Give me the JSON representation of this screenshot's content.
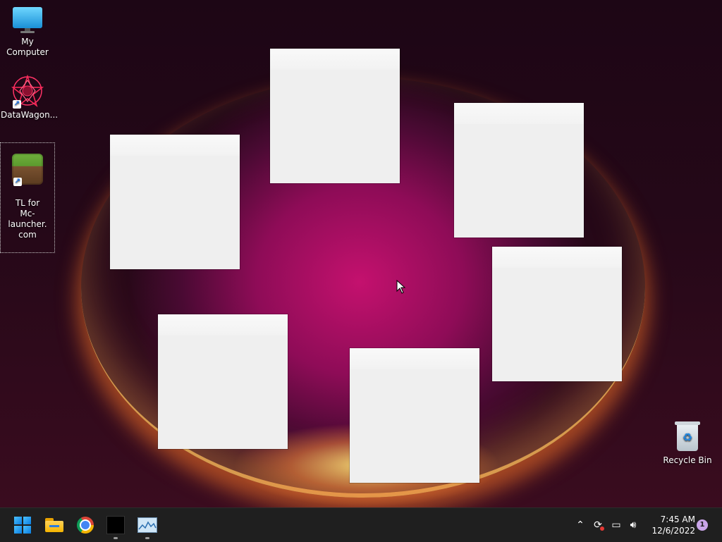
{
  "desktop": {
    "icons": [
      {
        "label": "My Computer"
      },
      {
        "label": "DataWagon..."
      },
      {
        "label": "TL for\nMc-launcher.\ncom"
      },
      {
        "label": "Recycle Bin"
      }
    ]
  },
  "taskbar": {
    "apps": [
      "start-icon",
      "file-explorer-icon",
      "chrome-icon",
      "black-app-icon",
      "monitor-app-icon"
    ],
    "clock": {
      "time": "7:45 AM",
      "date": "12/6/2022"
    },
    "notification_count": "1"
  },
  "colors": {
    "taskbar_bg": "#1f1f1f",
    "note_bg": "#efefef",
    "accent": "#0a7de0"
  }
}
